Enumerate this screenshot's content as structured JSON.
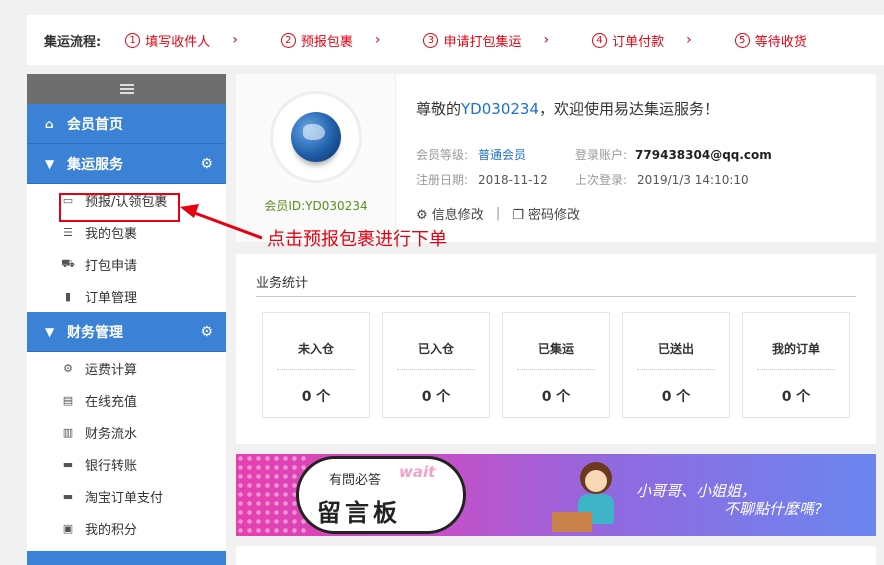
{
  "process": {
    "label": "集运流程:",
    "steps": [
      {
        "num": "1",
        "text": "填写收件人"
      },
      {
        "num": "2",
        "text": "预报包裹"
      },
      {
        "num": "3",
        "text": "申请打包集运"
      },
      {
        "num": "4",
        "text": "订单付款"
      },
      {
        "num": "5",
        "text": "等待收货"
      }
    ],
    "arrow": "›"
  },
  "sidebar": {
    "home": "会员首页",
    "sections": [
      {
        "title": "集运服务",
        "items": [
          "预报/认领包裹",
          "我的包裹",
          "打包申请",
          "订单管理"
        ]
      },
      {
        "title": "财务管理",
        "items": [
          "运费计算",
          "在线充值",
          "财务流水",
          "银行转账",
          "淘宝订单支付",
          "我的积分"
        ]
      }
    ]
  },
  "profile": {
    "member_id": "会员ID:YD030234",
    "welcome_prefix": "尊敬的",
    "welcome_user": "YD030234",
    "welcome_suffix": "，欢迎使用易达集运服务！",
    "level_label": "会员等级:",
    "level_value": "普通会员",
    "account_label": "登录账户:",
    "account_value": "779438304@qq.com",
    "reg_label": "注册日期:",
    "reg_value": "2018-11-12",
    "last_label": "上次登录:",
    "last_value": "2019/1/3 14:10:10",
    "edit_info": "信息修改",
    "sep": "|",
    "edit_pwd": "密码修改"
  },
  "annotation": {
    "text": "点击预报包裹进行下单",
    "color": "#e60012"
  },
  "stats": {
    "title": "业务统计",
    "cards": [
      {
        "label": "未入仓",
        "value": "0 个"
      },
      {
        "label": "已入仓",
        "value": "0 个"
      },
      {
        "label": "已集运",
        "value": "0 个"
      },
      {
        "label": "已送出",
        "value": "0 个"
      },
      {
        "label": "我的订单",
        "value": "0 个"
      }
    ]
  },
  "banner": {
    "small": "有問必答",
    "wait": "wait",
    "big": "留言板",
    "line1": "小哥哥、小姐姐，",
    "line2": "不聊點什麼嗎?"
  },
  "colors": {
    "accent": "#3b82d6",
    "red": "#e60012",
    "link": "#1f6fc9"
  }
}
